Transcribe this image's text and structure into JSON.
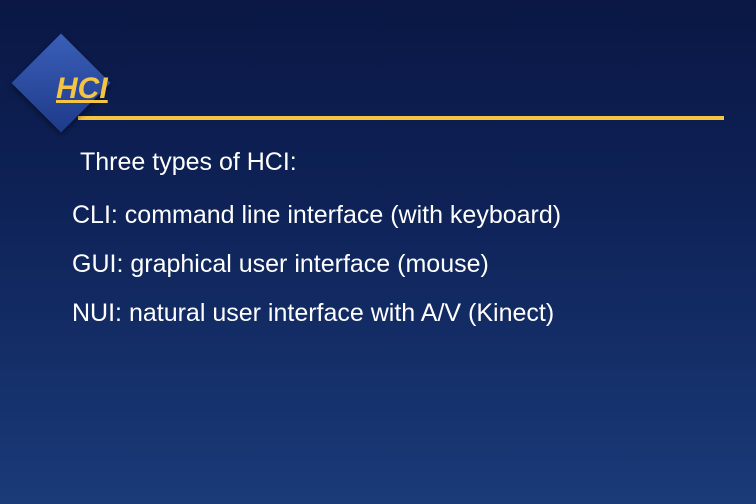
{
  "title": "HCI",
  "intro": "Three types of HCI:",
  "items": [
    "CLI: command line interface (with keyboard)",
    "GUI: graphical user interface (mouse)",
    "NUI: natural user interface with A/V (Kinect)"
  ]
}
